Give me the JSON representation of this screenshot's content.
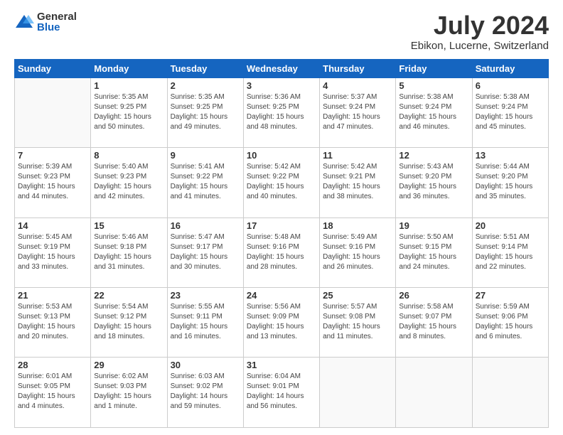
{
  "logo": {
    "general": "General",
    "blue": "Blue"
  },
  "header": {
    "title": "July 2024",
    "subtitle": "Ebikon, Lucerne, Switzerland"
  },
  "weekdays": [
    "Sunday",
    "Monday",
    "Tuesday",
    "Wednesday",
    "Thursday",
    "Friday",
    "Saturday"
  ],
  "weeks": [
    [
      {
        "day": "",
        "info": ""
      },
      {
        "day": "1",
        "info": "Sunrise: 5:35 AM\nSunset: 9:25 PM\nDaylight: 15 hours\nand 50 minutes."
      },
      {
        "day": "2",
        "info": "Sunrise: 5:35 AM\nSunset: 9:25 PM\nDaylight: 15 hours\nand 49 minutes."
      },
      {
        "day": "3",
        "info": "Sunrise: 5:36 AM\nSunset: 9:25 PM\nDaylight: 15 hours\nand 48 minutes."
      },
      {
        "day": "4",
        "info": "Sunrise: 5:37 AM\nSunset: 9:24 PM\nDaylight: 15 hours\nand 47 minutes."
      },
      {
        "day": "5",
        "info": "Sunrise: 5:38 AM\nSunset: 9:24 PM\nDaylight: 15 hours\nand 46 minutes."
      },
      {
        "day": "6",
        "info": "Sunrise: 5:38 AM\nSunset: 9:24 PM\nDaylight: 15 hours\nand 45 minutes."
      }
    ],
    [
      {
        "day": "7",
        "info": "Sunrise: 5:39 AM\nSunset: 9:23 PM\nDaylight: 15 hours\nand 44 minutes."
      },
      {
        "day": "8",
        "info": "Sunrise: 5:40 AM\nSunset: 9:23 PM\nDaylight: 15 hours\nand 42 minutes."
      },
      {
        "day": "9",
        "info": "Sunrise: 5:41 AM\nSunset: 9:22 PM\nDaylight: 15 hours\nand 41 minutes."
      },
      {
        "day": "10",
        "info": "Sunrise: 5:42 AM\nSunset: 9:22 PM\nDaylight: 15 hours\nand 40 minutes."
      },
      {
        "day": "11",
        "info": "Sunrise: 5:42 AM\nSunset: 9:21 PM\nDaylight: 15 hours\nand 38 minutes."
      },
      {
        "day": "12",
        "info": "Sunrise: 5:43 AM\nSunset: 9:20 PM\nDaylight: 15 hours\nand 36 minutes."
      },
      {
        "day": "13",
        "info": "Sunrise: 5:44 AM\nSunset: 9:20 PM\nDaylight: 15 hours\nand 35 minutes."
      }
    ],
    [
      {
        "day": "14",
        "info": "Sunrise: 5:45 AM\nSunset: 9:19 PM\nDaylight: 15 hours\nand 33 minutes."
      },
      {
        "day": "15",
        "info": "Sunrise: 5:46 AM\nSunset: 9:18 PM\nDaylight: 15 hours\nand 31 minutes."
      },
      {
        "day": "16",
        "info": "Sunrise: 5:47 AM\nSunset: 9:17 PM\nDaylight: 15 hours\nand 30 minutes."
      },
      {
        "day": "17",
        "info": "Sunrise: 5:48 AM\nSunset: 9:16 PM\nDaylight: 15 hours\nand 28 minutes."
      },
      {
        "day": "18",
        "info": "Sunrise: 5:49 AM\nSunset: 9:16 PM\nDaylight: 15 hours\nand 26 minutes."
      },
      {
        "day": "19",
        "info": "Sunrise: 5:50 AM\nSunset: 9:15 PM\nDaylight: 15 hours\nand 24 minutes."
      },
      {
        "day": "20",
        "info": "Sunrise: 5:51 AM\nSunset: 9:14 PM\nDaylight: 15 hours\nand 22 minutes."
      }
    ],
    [
      {
        "day": "21",
        "info": "Sunrise: 5:53 AM\nSunset: 9:13 PM\nDaylight: 15 hours\nand 20 minutes."
      },
      {
        "day": "22",
        "info": "Sunrise: 5:54 AM\nSunset: 9:12 PM\nDaylight: 15 hours\nand 18 minutes."
      },
      {
        "day": "23",
        "info": "Sunrise: 5:55 AM\nSunset: 9:11 PM\nDaylight: 15 hours\nand 16 minutes."
      },
      {
        "day": "24",
        "info": "Sunrise: 5:56 AM\nSunset: 9:09 PM\nDaylight: 15 hours\nand 13 minutes."
      },
      {
        "day": "25",
        "info": "Sunrise: 5:57 AM\nSunset: 9:08 PM\nDaylight: 15 hours\nand 11 minutes."
      },
      {
        "day": "26",
        "info": "Sunrise: 5:58 AM\nSunset: 9:07 PM\nDaylight: 15 hours\nand 8 minutes."
      },
      {
        "day": "27",
        "info": "Sunrise: 5:59 AM\nSunset: 9:06 PM\nDaylight: 15 hours\nand 6 minutes."
      }
    ],
    [
      {
        "day": "28",
        "info": "Sunrise: 6:01 AM\nSunset: 9:05 PM\nDaylight: 15 hours\nand 4 minutes."
      },
      {
        "day": "29",
        "info": "Sunrise: 6:02 AM\nSunset: 9:03 PM\nDaylight: 15 hours\nand 1 minute."
      },
      {
        "day": "30",
        "info": "Sunrise: 6:03 AM\nSunset: 9:02 PM\nDaylight: 14 hours\nand 59 minutes."
      },
      {
        "day": "31",
        "info": "Sunrise: 6:04 AM\nSunset: 9:01 PM\nDaylight: 14 hours\nand 56 minutes."
      },
      {
        "day": "",
        "info": ""
      },
      {
        "day": "",
        "info": ""
      },
      {
        "day": "",
        "info": ""
      }
    ]
  ]
}
